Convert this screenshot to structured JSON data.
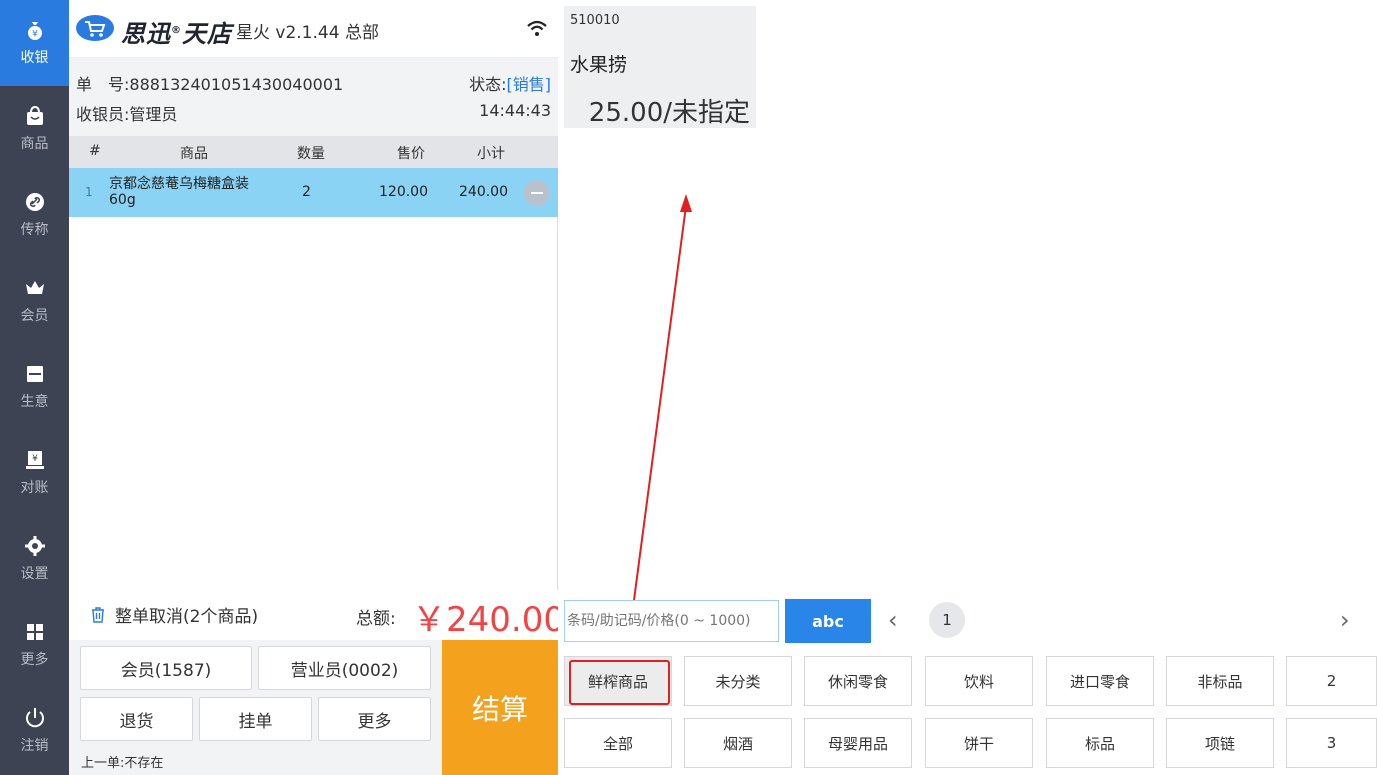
{
  "nav": {
    "items": [
      {
        "label": "收银",
        "icon": "money-bag-icon",
        "active": true
      },
      {
        "label": "商品",
        "icon": "shopping-bag-icon",
        "active": false
      },
      {
        "label": "传称",
        "icon": "link-icon",
        "active": false
      },
      {
        "label": "会员",
        "icon": "crown-icon",
        "active": false
      },
      {
        "label": "生意",
        "icon": "printer-icon",
        "active": false
      },
      {
        "label": "对账",
        "icon": "report-icon",
        "active": false
      },
      {
        "label": "设置",
        "icon": "gear-icon",
        "active": false
      },
      {
        "label": "更多",
        "icon": "grid-icon",
        "active": false
      },
      {
        "label": "注销",
        "icon": "power-icon",
        "active": false
      }
    ]
  },
  "brand": {
    "name": "思迅",
    "name2": "天店",
    "registered": "®",
    "version": "星火 v2.1.44  总部"
  },
  "order": {
    "number_label": "单　号:",
    "number": "888132401051430040001",
    "status_label": "状态:",
    "status": "[销售]",
    "cashier_label": "收银员:",
    "cashier": "管理员",
    "time": "14:44:43"
  },
  "table": {
    "headers": {
      "index": "#",
      "product": "商品",
      "qty": "数量",
      "price": "售价",
      "subtotal": "小计"
    },
    "rows": [
      {
        "index": "1",
        "product": "京都念慈菴乌梅糖盒装60g",
        "qty": "2",
        "price": "120.00",
        "subtotal": "240.00"
      }
    ]
  },
  "summary": {
    "cancel_all": "整单取消(2个商品)",
    "total_label": "总额:",
    "total": "￥240.00"
  },
  "actions": {
    "member": "会员(1587)",
    "salesperson": "营业员(0002)",
    "refund": "退货",
    "hold": "挂单",
    "more": "更多",
    "last_order": "上一单:不存在",
    "checkout": "结算"
  },
  "product": {
    "code": "510010",
    "name": "水果捞",
    "price": "25.00/未指定"
  },
  "search": {
    "placeholder": "条码/助记码/价格(0 ~ 1000)",
    "abc": "abc",
    "prev": "‹",
    "page": "1",
    "next": "›"
  },
  "categories": {
    "row1": [
      "鲜榨商品",
      "未分类",
      "休闲零食",
      "饮料",
      "进口零食",
      "非标品",
      "2"
    ],
    "row2": [
      "全部",
      "烟酒",
      "母婴用品",
      "饼干",
      "标品",
      "项链",
      "3"
    ],
    "selected": "鲜榨商品"
  },
  "colors": {
    "nav_bg": "#3d4353",
    "nav_active": "#2a7be0",
    "row_highlight": "#8bd3f5",
    "total_red": "#f04545",
    "checkout_orange": "#f4a11e",
    "abc_blue": "#2a85e8",
    "annotation_red": "#e02020"
  }
}
